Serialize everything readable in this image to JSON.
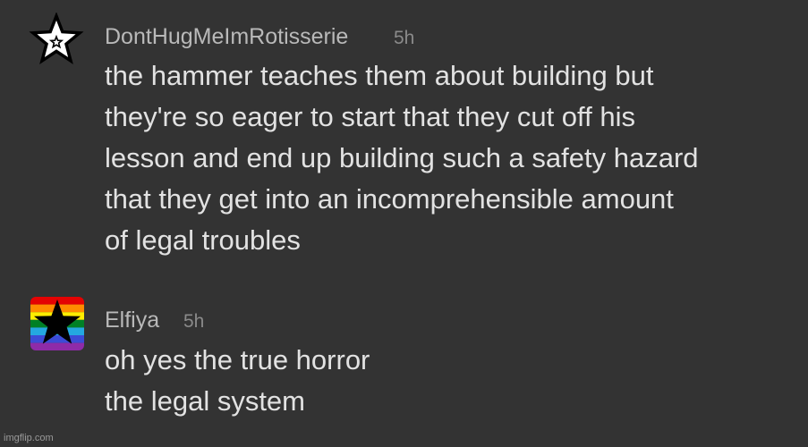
{
  "comments": [
    {
      "username": "DontHugMeImRotisserie",
      "time": "5h",
      "avatar_icon": "star-outline-icon",
      "lines": [
        "the hammer teaches them about building but",
        "they're so eager to start that they cut off his",
        "lesson and end up building such a safety hazard",
        "that they get into an incomprehensible amount",
        "of legal troubles"
      ]
    },
    {
      "username": "Elfiya",
      "time": "5h",
      "avatar_icon": "rainbow-star-icon",
      "lines": [
        "oh yes the true horror",
        "the legal system"
      ]
    }
  ],
  "watermark": "imgflip.com",
  "colors": {
    "background": "#333333",
    "username": "#b9b9b9",
    "timestamp": "#8a8a8a",
    "body_text": "#e2e2e2"
  }
}
